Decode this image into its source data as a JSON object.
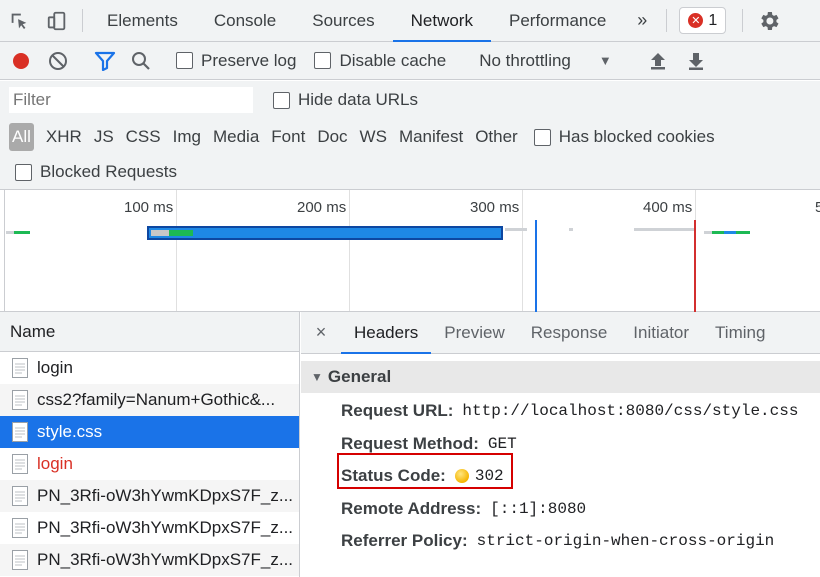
{
  "top_tabs": [
    "Elements",
    "Console",
    "Sources",
    "Network",
    "Performance"
  ],
  "active_tab": "Network",
  "more_label": "»",
  "error_count": "1",
  "toolbar": {
    "preserve_log": "Preserve log",
    "disable_cache": "Disable cache",
    "throttling": "No throttling"
  },
  "filter": {
    "placeholder": "Filter",
    "hide_data_urls": "Hide data URLs"
  },
  "types": [
    "All",
    "XHR",
    "JS",
    "CSS",
    "Img",
    "Media",
    "Font",
    "Doc",
    "WS",
    "Manifest",
    "Other"
  ],
  "has_blocked_cookies": "Has blocked cookies",
  "blocked_requests": "Blocked Requests",
  "timeline_ticks": [
    "100 ms",
    "200 ms",
    "300 ms",
    "400 ms",
    "5"
  ],
  "request_list": {
    "header": "Name",
    "rows": [
      {
        "name": "login",
        "state": "normal"
      },
      {
        "name": "css2?family=Nanum+Gothic&...",
        "state": "normal"
      },
      {
        "name": "style.css",
        "state": "selected"
      },
      {
        "name": "login",
        "state": "error"
      },
      {
        "name": "PN_3Rfi-oW3hYwmKDpxS7F_z...",
        "state": "normal"
      },
      {
        "name": "PN_3Rfi-oW3hYwmKDpxS7F_z...",
        "state": "normal"
      },
      {
        "name": "PN_3Rfi-oW3hYwmKDpxS7F_z...",
        "state": "normal"
      }
    ]
  },
  "details": {
    "close": "×",
    "tabs": [
      "Headers",
      "Preview",
      "Response",
      "Initiator",
      "Timing"
    ],
    "active_tab": "Headers",
    "section": "General",
    "general": [
      {
        "key": "Request URL:",
        "value": "http://localhost:8080/css/style.css"
      },
      {
        "key": "Request Method:",
        "value": "GET"
      },
      {
        "key": "Status Code:",
        "value": "302"
      },
      {
        "key": "Remote Address:",
        "value": "[::1]:8080"
      },
      {
        "key": "Referrer Policy:",
        "value": "strict-origin-when-cross-origin"
      }
    ]
  },
  "colors": {
    "accent": "#1a73e8",
    "record": "#d93025",
    "status_warning": "#f5b400"
  }
}
